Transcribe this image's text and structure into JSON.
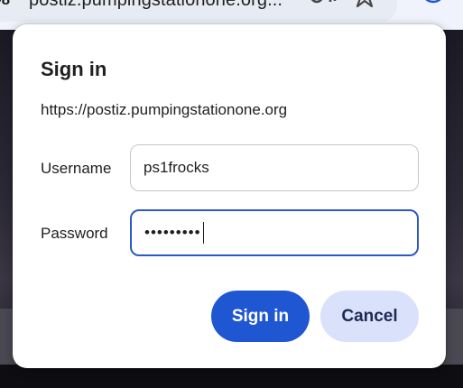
{
  "browser": {
    "url_text": "postiz.pumpingstationone.org...",
    "site_chip": "-8",
    "icons": [
      "key-icon",
      "star-icon",
      "profile-icon"
    ]
  },
  "dialog": {
    "title": "Sign in",
    "origin": "https://postiz.pumpingstationone.org",
    "username_label": "Username",
    "username_value": "ps1frocks",
    "password_label": "Password",
    "password_value": "•••••••••",
    "signin_label": "Sign in",
    "cancel_label": "Cancel"
  },
  "colors": {
    "primary": "#1f56d2",
    "secondary": "#dae2fb",
    "focus_border": "#2c59c9"
  }
}
